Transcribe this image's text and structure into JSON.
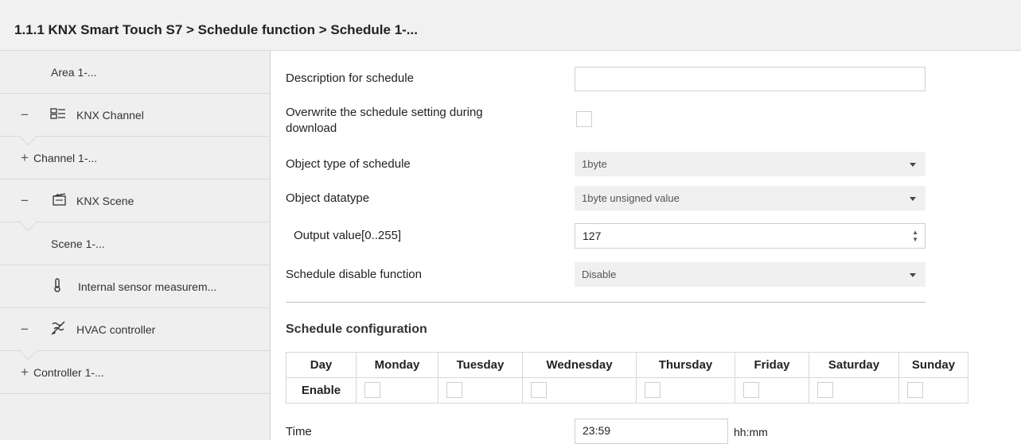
{
  "window": {
    "title": "1.1.1 KNX Smart Touch S7 > Schedule function > Schedule 1-..."
  },
  "sidebar": {
    "items": [
      {
        "sign": "",
        "icon": "",
        "label": "Area 1-..."
      },
      {
        "sign": "−",
        "icon": "channel-icon",
        "label": "KNX Channel"
      },
      {
        "sign": "+",
        "icon": "",
        "label": "Channel 1-..."
      },
      {
        "sign": "−",
        "icon": "scene-icon",
        "label": "KNX Scene"
      },
      {
        "sign": "",
        "icon": "",
        "label": "Scene 1-..."
      },
      {
        "sign": "",
        "icon": "thermometer-icon",
        "label": "Internal sensor measurem..."
      },
      {
        "sign": "−",
        "icon": "hvac-icon",
        "label": "HVAC controller"
      },
      {
        "sign": "+",
        "icon": "",
        "label": "Controller 1-..."
      }
    ]
  },
  "form": {
    "description_label": "Description for schedule",
    "description_value": "",
    "overwrite_label_line1": "Overwrite the schedule setting during",
    "overwrite_label_line2": "download",
    "object_type_label": "Object type of schedule",
    "object_type_value": "1byte",
    "object_datatype_label": "Object datatype",
    "object_datatype_value": "1byte unsigned value",
    "output_value_label": "Output value[0..255]",
    "output_value": "127",
    "disable_function_label": "Schedule disable function",
    "disable_function_value": "Disable"
  },
  "schedule": {
    "section_title": "Schedule configuration",
    "day_header": "Day",
    "enable_label": "Enable",
    "days": [
      "Monday",
      "Tuesday",
      "Wednesday",
      "Thursday",
      "Friday",
      "Saturday",
      "Sunday"
    ],
    "time_label": "Time",
    "time_value": "23:59",
    "time_unit": "hh:mm"
  }
}
